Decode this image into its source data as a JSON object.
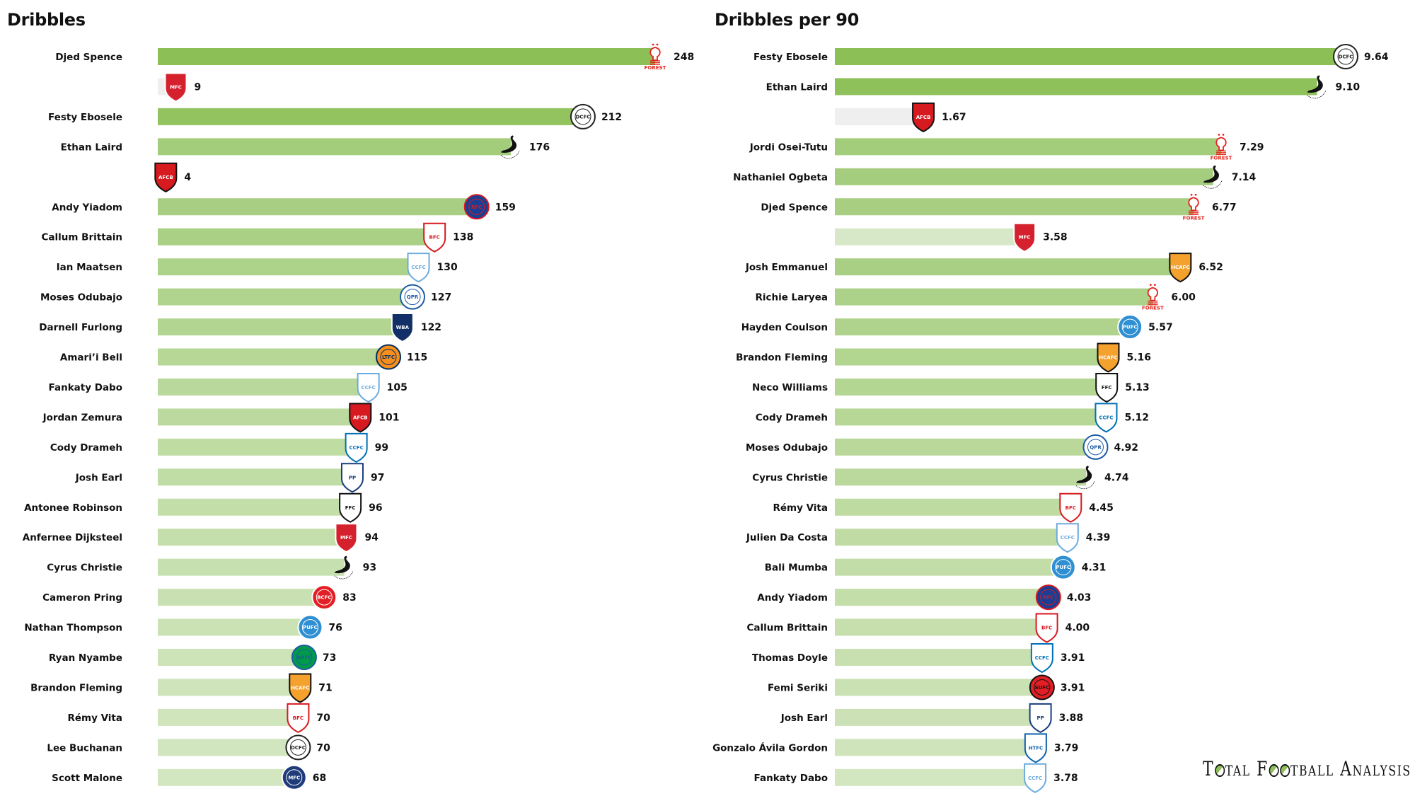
{
  "teams": {
    "forest": {
      "name": "Nottingham Forest",
      "primary": "#e3241c",
      "secondary": "#ffffff",
      "shape": "tree",
      "abbr": "NFFC"
    },
    "middlesbrough": {
      "name": "Middlesbrough",
      "primary": "#d5212e",
      "secondary": "#ffffff",
      "shape": "shield",
      "abbr": "MFC"
    },
    "derby": {
      "name": "Derby County",
      "primary": "#ffffff",
      "secondary": "#222222",
      "shape": "circle",
      "abbr": "DCFC"
    },
    "swansea": {
      "name": "Swansea City",
      "primary": "#ffffff",
      "secondary": "#111111",
      "shape": "swan",
      "abbr": "S"
    },
    "bournemouth": {
      "name": "AFC Bournemouth",
      "primary": "#d71920",
      "secondary": "#111111",
      "shape": "shield",
      "abbr": "AFCB"
    },
    "reading": {
      "name": "Reading",
      "primary": "#1b3e94",
      "secondary": "#d71920",
      "shape": "circle",
      "abbr": "RFC"
    },
    "barnsley": {
      "name": "Barnsley",
      "primary": "#ffffff",
      "secondary": "#d71920",
      "shape": "shield",
      "abbr": "BFC"
    },
    "coventry": {
      "name": "Coventry City",
      "primary": "#ffffff",
      "secondary": "#6cabdd",
      "shape": "shield",
      "abbr": "CCFC"
    },
    "qpr": {
      "name": "Queens Park Rangers",
      "primary": "#ffffff",
      "secondary": "#1d5ba4",
      "shape": "circle",
      "abbr": "QPR"
    },
    "westbrom": {
      "name": "West Bromwich Albion",
      "primary": "#122f67",
      "secondary": "#ffffff",
      "shape": "shield",
      "abbr": "WBA"
    },
    "luton": {
      "name": "Luton Town",
      "primary": "#f78f1e",
      "secondary": "#002d62",
      "shape": "circle",
      "abbr": "LTFC"
    },
    "cardiff": {
      "name": "Cardiff City",
      "primary": "#ffffff",
      "secondary": "#0070b5",
      "shape": "shield",
      "abbr": "CCFC"
    },
    "preston": {
      "name": "Preston North End",
      "primary": "#ffffff",
      "secondary": "#1a3d7c",
      "shape": "shield",
      "abbr": "PP"
    },
    "fulham": {
      "name": "Fulham",
      "primary": "#ffffff",
      "secondary": "#111111",
      "shape": "shield",
      "abbr": "FFC"
    },
    "bristol": {
      "name": "Bristol City",
      "primary": "#e21f26",
      "secondary": "#ffffff",
      "shape": "circle",
      "abbr": "BCFC"
    },
    "peterborough": {
      "name": "Peterborough United",
      "primary": "#2e8fd3",
      "secondary": "#ffffff",
      "shape": "circle",
      "abbr": "PUFC"
    },
    "blackburn": {
      "name": "Blackburn Rovers",
      "primary": "#009b48",
      "secondary": "#1d5ba4",
      "shape": "circle",
      "abbr": "BRFC"
    },
    "hull": {
      "name": "Hull City",
      "primary": "#f5a12d",
      "secondary": "#111111",
      "shape": "shield",
      "abbr": "HCAFC"
    },
    "millwall": {
      "name": "Millwall",
      "primary": "#1f3b7a",
      "secondary": "#ffffff",
      "shape": "circle",
      "abbr": "MFC"
    },
    "sheffield": {
      "name": "Sheffield United",
      "primary": "#e21f26",
      "secondary": "#111111",
      "shape": "circle",
      "abbr": "SUFC"
    },
    "huddersfield": {
      "name": "Huddersfield Town",
      "primary": "#ffffff",
      "secondary": "#0e63ad",
      "shape": "shield",
      "abbr": "HTFC"
    }
  },
  "brand": {
    "text": "Total Football Analysis"
  },
  "chart_data": [
    {
      "type": "bar",
      "orientation": "horizontal",
      "title": "Dribbles",
      "xlabel": "",
      "ylabel": "",
      "xlim": [
        0,
        248
      ],
      "grid": false,
      "legend": "none",
      "rows": [
        {
          "player": "Djed Spence",
          "value": 248,
          "label": "248",
          "team": "forest",
          "color": "#8cbf56"
        },
        {
          "player": "",
          "value": 9,
          "label": "9",
          "team": "middlesbrough",
          "color": "#efefef"
        },
        {
          "player": "Festy Ebosele",
          "value": 212,
          "label": "212",
          "team": "derby",
          "color": "#93c35f"
        },
        {
          "player": "Ethan Laird",
          "value": 176,
          "label": "176",
          "team": "swansea",
          "color": "#a3cc7b"
        },
        {
          "player": "",
          "value": 4,
          "label": "4",
          "team": "bournemouth",
          "color": "#efefef"
        },
        {
          "player": "Andy Yiadom",
          "value": 159,
          "label": "159",
          "team": "reading",
          "color": "#a7ce82"
        },
        {
          "player": "Callum Brittain",
          "value": 138,
          "label": "138",
          "team": "barnsley",
          "color": "#aad086"
        },
        {
          "player": "Ian Maatsen",
          "value": 130,
          "label": "130",
          "team": "coventry",
          "color": "#add28a"
        },
        {
          "player": "Moses Odubajo",
          "value": 127,
          "label": "127",
          "team": "qpr",
          "color": "#b0d48e"
        },
        {
          "player": "Darnell Furlong",
          "value": 122,
          "label": "122",
          "team": "westbrom",
          "color": "#b3d592"
        },
        {
          "player": "Amari’i Bell",
          "value": 115,
          "label": "115",
          "team": "luton",
          "color": "#b6d796"
        },
        {
          "player": "Fankaty Dabo",
          "value": 105,
          "label": "105",
          "team": "coventry",
          "color": "#b9d89b"
        },
        {
          "player": "Jordan Zemura",
          "value": 101,
          "label": "101",
          "team": "bournemouth",
          "color": "#bcda9f"
        },
        {
          "player": "Cody Drameh",
          "value": 99,
          "label": "99",
          "team": "cardiff",
          "color": "#bfdca3"
        },
        {
          "player": "Josh Earl",
          "value": 97,
          "label": "97",
          "team": "preston",
          "color": "#c1dda6"
        },
        {
          "player": "Antonee Robinson",
          "value": 96,
          "label": "96",
          "team": "fulham",
          "color": "#c3dea9"
        },
        {
          "player": "Anfernee Dijksteel",
          "value": 94,
          "label": "94",
          "team": "middlesbrough",
          "color": "#c5dfac"
        },
        {
          "player": "Cyrus Christie",
          "value": 93,
          "label": "93",
          "team": "swansea",
          "color": "#c7e0af"
        },
        {
          "player": "Cameron Pring",
          "value": 83,
          "label": "83",
          "team": "bristol",
          "color": "#c9e1b2"
        },
        {
          "player": "Nathan Thompson",
          "value": 76,
          "label": "76",
          "team": "peterborough",
          "color": "#cbe2b5"
        },
        {
          "player": "Ryan Nyambe",
          "value": 73,
          "label": "73",
          "team": "blackburn",
          "color": "#cde3b8"
        },
        {
          "player": "Brandon Fleming",
          "value": 71,
          "label": "71",
          "team": "hull",
          "color": "#cfe4ba"
        },
        {
          "player": "Rémy Vita",
          "value": 70,
          "label": "70",
          "team": "barnsley",
          "color": "#d0e5bc"
        },
        {
          "player": "Lee Buchanan",
          "value": 70,
          "label": "70",
          "team": "derby",
          "color": "#d1e5be"
        },
        {
          "player": "Scott Malone",
          "value": 68,
          "label": "68",
          "team": "millwall",
          "color": "#d2e6c0"
        }
      ]
    },
    {
      "type": "bar",
      "orientation": "horizontal",
      "title": "Dribbles per 90",
      "xlabel": "",
      "ylabel": "",
      "xlim": [
        0,
        9.64
      ],
      "grid": false,
      "legend": "none",
      "rows": [
        {
          "player": "Festy Ebosele",
          "value": 9.64,
          "label": "9.64",
          "team": "derby",
          "color": "#8cbf56"
        },
        {
          "player": "Ethan Laird",
          "value": 9.1,
          "label": "9.10",
          "team": "swansea",
          "color": "#8fc15a"
        },
        {
          "player": "",
          "value": 1.67,
          "label": "1.67",
          "team": "bournemouth",
          "color": "#efefef"
        },
        {
          "player": "Jordi Osei-Tutu",
          "value": 7.29,
          "label": "7.29",
          "team": "forest",
          "color": "#a3cc7b"
        },
        {
          "player": "Nathaniel Ogbeta",
          "value": 7.14,
          "label": "7.14",
          "team": "swansea",
          "color": "#a5cd7e"
        },
        {
          "player": "Djed Spence",
          "value": 6.77,
          "label": "6.77",
          "team": "forest",
          "color": "#a7ce81"
        },
        {
          "player": "",
          "value": 3.58,
          "label": "3.58",
          "team": "middlesbrough",
          "color": "#d7e8c8"
        },
        {
          "player": "Josh Emmanuel",
          "value": 6.52,
          "label": "6.52",
          "team": "hull",
          "color": "#a9cf84"
        },
        {
          "player": "Richie Laryea",
          "value": 6.0,
          "label": "6.00",
          "team": "forest",
          "color": "#acd188"
        },
        {
          "player": "Hayden Coulson",
          "value": 5.57,
          "label": "5.57",
          "team": "peterborough",
          "color": "#afd38c"
        },
        {
          "player": "Brandon Fleming",
          "value": 5.16,
          "label": "5.16",
          "team": "hull",
          "color": "#b2d590"
        },
        {
          "player": "Neco Williams",
          "value": 5.13,
          "label": "5.13",
          "team": "fulham",
          "color": "#b4d693"
        },
        {
          "player": "Cody Drameh",
          "value": 5.12,
          "label": "5.12",
          "team": "cardiff",
          "color": "#b6d796"
        },
        {
          "player": "Moses Odubajo",
          "value": 4.92,
          "label": "4.92",
          "team": "qpr",
          "color": "#b9d89a"
        },
        {
          "player": "Cyrus Christie",
          "value": 4.74,
          "label": "4.74",
          "team": "swansea",
          "color": "#bbd99d"
        },
        {
          "player": "Rémy Vita",
          "value": 4.45,
          "label": "4.45",
          "team": "barnsley",
          "color": "#bedba1"
        },
        {
          "player": "Julien Da Costa",
          "value": 4.39,
          "label": "4.39",
          "team": "coventry",
          "color": "#c0dca4"
        },
        {
          "player": "Bali Mumba",
          "value": 4.31,
          "label": "4.31",
          "team": "peterborough",
          "color": "#c2dda7"
        },
        {
          "player": "Andy Yiadom",
          "value": 4.03,
          "label": "4.03",
          "team": "reading",
          "color": "#c4deaa"
        },
        {
          "player": "Callum Brittain",
          "value": 4.0,
          "label": "4.00",
          "team": "barnsley",
          "color": "#c6dfad"
        },
        {
          "player": "Thomas Doyle",
          "value": 3.91,
          "label": "3.91",
          "team": "cardiff",
          "color": "#c8e0b0"
        },
        {
          "player": "Femi Seriki",
          "value": 3.91,
          "label": "3.91",
          "team": "sheffield",
          "color": "#cae1b3"
        },
        {
          "player": "Josh Earl",
          "value": 3.88,
          "label": "3.88",
          "team": "preston",
          "color": "#cce2b6"
        },
        {
          "player": "Gonzalo Ávila Gordon",
          "value": 3.79,
          "label": "3.79",
          "team": "huddersfield",
          "color": "#cfe4ba"
        },
        {
          "player": "Fankaty Dabo",
          "value": 3.78,
          "label": "3.78",
          "team": "coventry",
          "color": "#d2e6c0"
        }
      ]
    }
  ]
}
